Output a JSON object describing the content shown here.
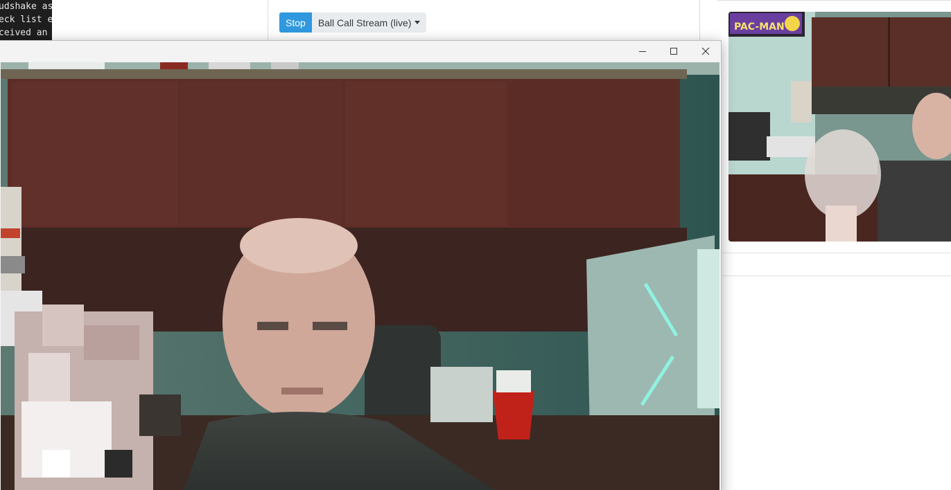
{
  "terminal": {
    "lines": [
      "udshake as",
      "eck list e",
      "ceived an"
    ]
  },
  "controls": {
    "stop_label": "Stop",
    "stream_label": "Ball Call Stream (live)"
  },
  "preview": {
    "sign_text": "PAC-MAN"
  },
  "window": {
    "minimize_icon": "minimize-icon",
    "maximize_icon": "maximize-icon",
    "close_icon": "close-icon"
  },
  "colors": {
    "stop_button": "#2f98de",
    "stream_button": "#e9ecef",
    "terminal_bg": "#1e1e1e"
  }
}
